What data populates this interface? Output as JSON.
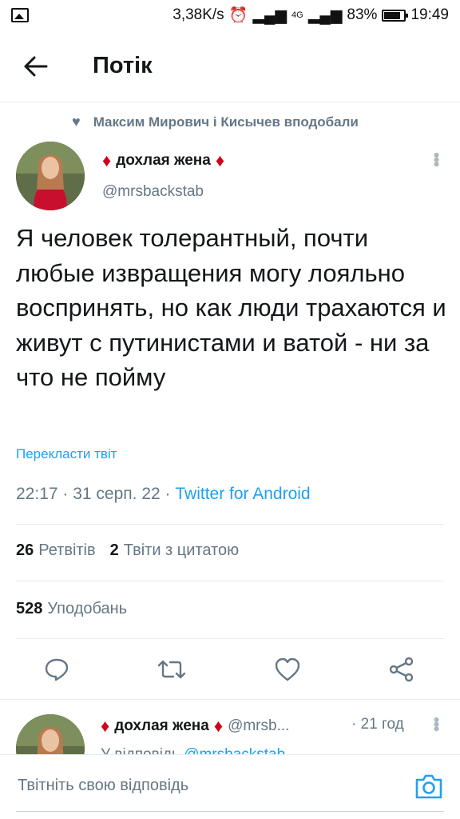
{
  "statusbar": {
    "speed": "3,38K/s",
    "network": "4G",
    "battery": "83%",
    "time": "19:49"
  },
  "header": {
    "title": "Потік"
  },
  "liked_by": "Максим Мирович і Кисычев вподобали",
  "tweet": {
    "author_name": "дохлая жена",
    "handle": "@mrsbackstab",
    "text": "Я человек толерантный, почти любые извращения могу лояльно воспринять, но как люди трахаются и живут с путинистами и ватой - ни за что не пойму",
    "translate_label": "Перекласти твіт",
    "time": "22:17",
    "date": "31 серп. 22",
    "app": "Twitter for Android"
  },
  "stats": {
    "retweets_count": "26",
    "retweets_label": "Ретвітів",
    "quotes_count": "2",
    "quotes_label": "Твіти з цитатою",
    "likes_count": "528",
    "likes_label": "Уподобань"
  },
  "reply": {
    "author_name": "дохлая жена",
    "handle_truncated": "@mrsb...",
    "time": "21 год",
    "reply_to_prefix": "У відповідь",
    "reply_to_handle": "@mrsbackstab"
  },
  "compose": {
    "placeholder": "Твітніть свою відповідь"
  },
  "colors": {
    "accent": "#1da1f2",
    "secondary_text": "#657786",
    "diamond": "#d0021b"
  }
}
